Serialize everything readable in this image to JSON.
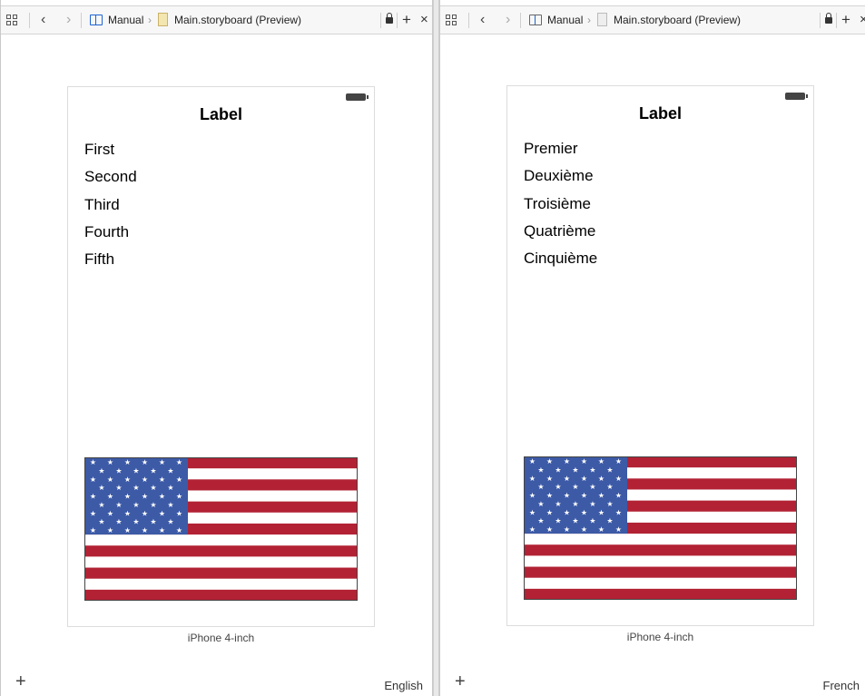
{
  "left": {
    "breadcrumb": {
      "group": "Manual",
      "file": "Main.storyboard (Preview)"
    },
    "title": "Label",
    "items": [
      "First",
      "Second",
      "Third",
      "Fourth",
      "Fifth"
    ],
    "device_caption": "iPhone 4-inch",
    "language": "English"
  },
  "right": {
    "breadcrumb": {
      "group": "Manual",
      "file": "Main.storyboard (Preview)"
    },
    "title": "Label",
    "items": [
      "Premier",
      "Deuxième",
      "Troisième",
      "Quatrième",
      "Cinquième"
    ],
    "device_caption": "iPhone 4-inch",
    "language": "French"
  },
  "icons": {
    "grid": "grid-icon",
    "back": "chevron-left-icon",
    "forward": "chevron-right-icon",
    "split": "split-view-icon",
    "file": "storyboard-file-icon",
    "lock": "lock-icon",
    "add": "plus-icon",
    "close": "close-icon",
    "flag": "us-flag-image"
  },
  "colors": {
    "accent": "#1e64d0",
    "flag_red": "#b22234",
    "flag_blue": "#3c5aa6",
    "flag_white": "#ffffff"
  }
}
